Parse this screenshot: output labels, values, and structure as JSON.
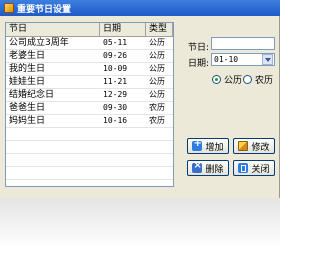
{
  "window": {
    "title": "重要节日设置"
  },
  "list": {
    "headers": [
      "节日",
      "日期",
      "类型"
    ],
    "rows": [
      [
        "公司成立3周年",
        "05-11",
        "公历"
      ],
      [
        "老婆生日",
        "09-26",
        "公历"
      ],
      [
        "我的生日",
        "10-09",
        "公历"
      ],
      [
        "娃娃生日",
        "11-21",
        "公历"
      ],
      [
        "结婚纪念日",
        "12-29",
        "公历"
      ],
      [
        "爸爸生日",
        "09-30",
        "农历"
      ],
      [
        "妈妈生日",
        "10-16",
        "农历"
      ]
    ]
  },
  "form": {
    "festival_label": "节日:",
    "festival_value": "",
    "date_label": "日期:",
    "date_value": "01-10",
    "radio_solar": "公历",
    "radio_lunar": "农历",
    "selected_calendar": "公历"
  },
  "buttons": {
    "add": "增加",
    "edit": "修改",
    "delete": "删除",
    "close": "关闭"
  },
  "icons": {
    "app": "app-icon",
    "add": "add-icon",
    "edit": "edit-icon",
    "delete": "delete-icon",
    "close": "close-icon",
    "dropdown": "chevron-down-icon"
  },
  "colors": {
    "titlebar": "#1e5bc6",
    "window_bg": "#ece9d8",
    "button_border": "#003c74",
    "field_border": "#7f9db9"
  }
}
